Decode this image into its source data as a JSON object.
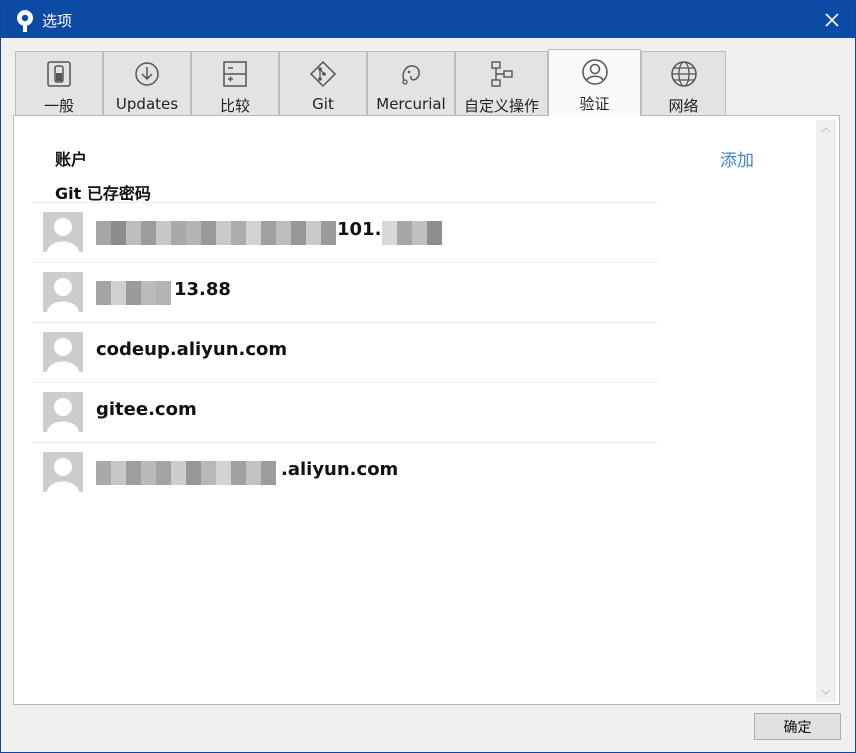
{
  "window": {
    "title": "选项"
  },
  "tabs": [
    {
      "label": "一般",
      "icon": "toggle-switch-icon"
    },
    {
      "label": "Updates",
      "icon": "download-circle-icon"
    },
    {
      "label": "比较",
      "icon": "diff-icon"
    },
    {
      "label": "Git",
      "icon": "git-icon"
    },
    {
      "label": "Mercurial",
      "icon": "mercurial-icon"
    },
    {
      "label": "自定义操作",
      "icon": "workflow-icon"
    },
    {
      "label": "验证",
      "icon": "user-circle-icon",
      "active": true
    },
    {
      "label": "网络",
      "icon": "globe-icon"
    }
  ],
  "auth": {
    "accounts_title": "账户",
    "add_label": "添加",
    "git_saved_title": "Git 已存密码",
    "entries": [
      {
        "host": "101.2"
      },
      {
        "host": "13.88"
      },
      {
        "host": "codeup.aliyun.com"
      },
      {
        "host": "gitee.com"
      },
      {
        "host": ".aliyun.com"
      }
    ]
  },
  "footer": {
    "ok_label": "确定"
  },
  "colors": {
    "titlebar": "#0c4aa6",
    "link": "#3b8ad9",
    "avatar": "#cdcdcd"
  }
}
